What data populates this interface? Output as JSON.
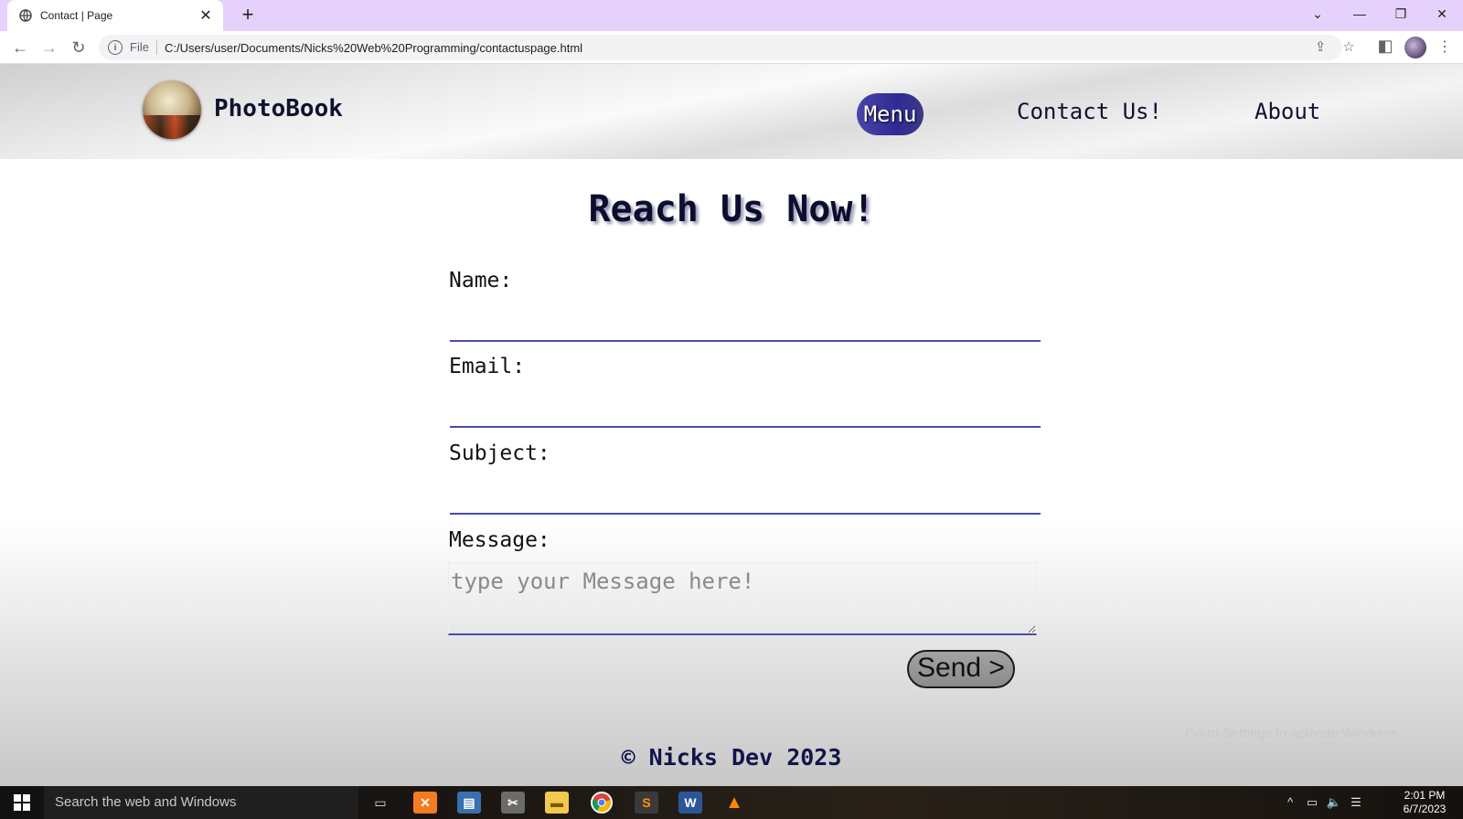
{
  "browser": {
    "tab_title": "Contact | Page",
    "new_tab_label": "+",
    "address_scheme_label": "File",
    "url": "C:/Users/user/Documents/Nicks%20Web%20Programming/contactuspage.html"
  },
  "site": {
    "brand": "PhotoBook",
    "nav": {
      "menu": "Menu",
      "contact": "Contact Us!",
      "about": "About"
    },
    "heading": "Reach Us Now!",
    "form": {
      "name_label": "Name:",
      "email_label": "Email:",
      "subject_label": "Subject:",
      "message_label": "Message:",
      "message_placeholder": "type your Message here!",
      "name_value": "",
      "email_value": "",
      "subject_value": "",
      "send_label": "Send >"
    },
    "footer": "© Nicks Dev 2023",
    "watermark": "Go to Settings to activate Windows."
  },
  "taskbar": {
    "search_placeholder": "Search the web and Windows",
    "time": "2:01 PM",
    "date": "6/7/2023"
  },
  "colors": {
    "tab_strip": "#e5d1fb",
    "accent_navy": "#0b0e2e",
    "menu_pill": "#2e2b94",
    "input_underline": "#4a4cae"
  }
}
